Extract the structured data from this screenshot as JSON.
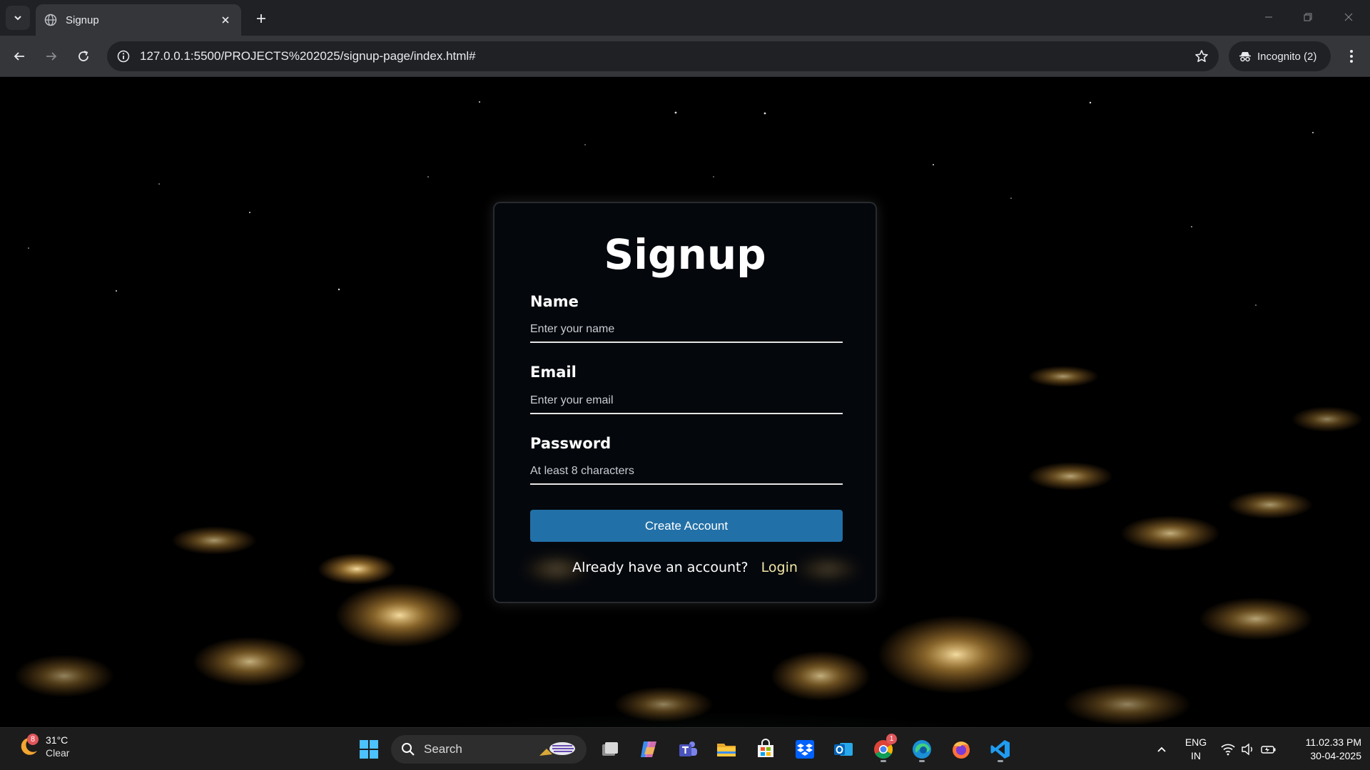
{
  "browser": {
    "tab_title": "Signup",
    "url": "127.0.0.1:5500/PROJECTS%202025/signup-page/index.html#",
    "incognito_label": "Incognito (2)"
  },
  "form": {
    "title": "Signup",
    "name_label": "Name",
    "name_placeholder": "Enter your name",
    "email_label": "Email",
    "email_placeholder": "Enter your email",
    "password_label": "Password",
    "password_placeholder": "At least 8 characters",
    "submit_label": "Create Account",
    "login_prompt": "Already have an account?",
    "login_link": "Login"
  },
  "taskbar": {
    "weather_badge": "8",
    "weather_temp": "31°C",
    "weather_cond": "Clear",
    "search_label": "Search",
    "chrome_badge": "1",
    "lang_top": "ENG",
    "lang_bottom": "IN",
    "time": "11.02.33 PM",
    "date": "30-04-2025"
  },
  "colors": {
    "accent_button": "#2270a8",
    "login_link": "#f3e7a6",
    "browser_frame": "#202124",
    "toolbar": "#35363a"
  },
  "icons": [
    "tab-list-icon",
    "globe-icon",
    "close-icon",
    "plus-icon",
    "minimize-icon",
    "restore-icon",
    "back-icon",
    "forward-icon",
    "reload-icon",
    "info-icon",
    "star-icon",
    "incognito-icon",
    "kebab-menu-icon",
    "weather-moon-icon",
    "windows-start-icon",
    "search-icon",
    "task-view-icon",
    "copilot-icon",
    "teams-icon",
    "file-explorer-icon",
    "store-icon",
    "dropbox-icon",
    "outlook-icon",
    "chrome-icon",
    "edge-icon",
    "firefox-icon",
    "vscode-icon",
    "chevron-up-icon",
    "wifi-icon",
    "volume-icon",
    "battery-icon"
  ]
}
